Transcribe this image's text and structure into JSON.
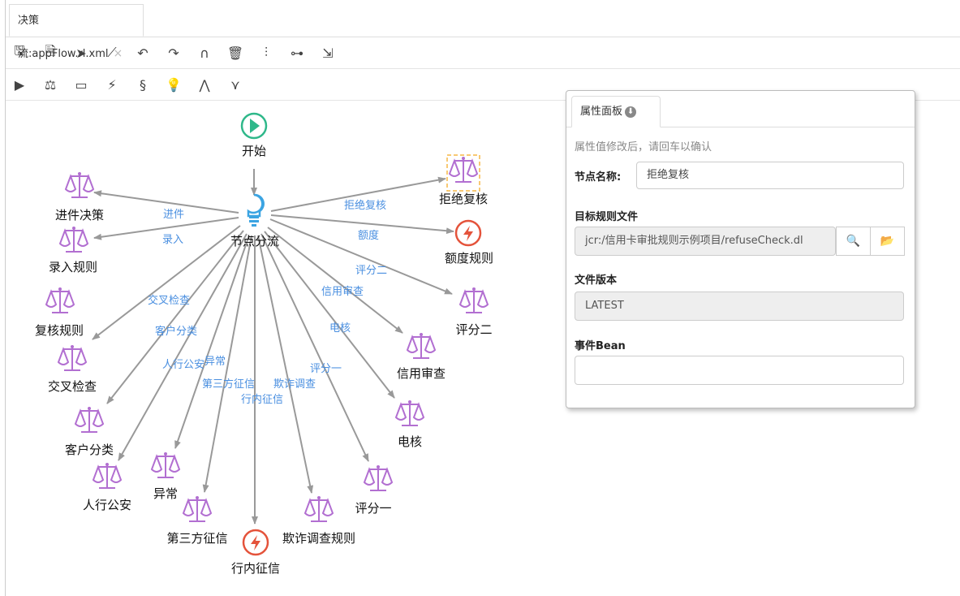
{
  "tab": {
    "title": "决策流:appFlow.rl.xml",
    "close": "×"
  },
  "toolbar1": [
    {
      "name": "save-icon",
      "glyph": "🖫"
    },
    {
      "name": "save-as-icon",
      "glyph": "🗎"
    },
    {
      "name": "pointer-icon",
      "glyph": "➤"
    },
    {
      "name": "connection-icon",
      "glyph": "⟋"
    },
    {
      "name": "undo-icon",
      "glyph": "↶"
    },
    {
      "name": "redo-icon",
      "glyph": "↷"
    },
    {
      "name": "magnet-icon",
      "glyph": "∩"
    },
    {
      "name": "delete-icon",
      "glyph": "🗑"
    },
    {
      "name": "align-vertical-icon",
      "glyph": "⫶"
    },
    {
      "name": "align-horizontal-icon",
      "glyph": "⊶"
    },
    {
      "name": "shrink-icon",
      "glyph": "⇲"
    }
  ],
  "toolbar2": [
    {
      "name": "start-node-icon",
      "glyph": "▶"
    },
    {
      "name": "rule-node-icon",
      "glyph": "⚖"
    },
    {
      "name": "package-node-icon",
      "glyph": "▭"
    },
    {
      "name": "action-node-icon",
      "glyph": "⚡"
    },
    {
      "name": "script-node-icon",
      "glyph": "§"
    },
    {
      "name": "decision-node-icon",
      "glyph": "💡"
    },
    {
      "name": "fork-node-icon",
      "glyph": "⋀"
    },
    {
      "name": "join-node-icon",
      "glyph": "⋎"
    }
  ],
  "flow": {
    "start": "开始",
    "split": "节点分流",
    "nodes": {
      "jinjian": "进件决策",
      "luru": "录入规则",
      "fuhe": "复核规则",
      "jiaocha": "交叉检查",
      "kehu": "客户分类",
      "renhang": "人行公安",
      "yichang": "异常",
      "disanfang": "第三方征信",
      "hangnei": "行内征信",
      "qizha": "欺诈调查规则",
      "pingfen1": "评分一",
      "dianhe": "电核",
      "xinyong": "信用审查",
      "pingfen2": "评分二",
      "edu": "额度规则",
      "jujue": "拒绝复核"
    },
    "edges": {
      "jinjian": "进件",
      "luru": "录入",
      "jiaocha": "交叉检查",
      "kehu": "客户分类",
      "renhang": "人行公安",
      "yichang": "异常",
      "disanfang": "第三方征信",
      "hangnei": "行内征信",
      "qizha": "欺诈调查",
      "pingfen1": "评分一",
      "dianhe": "电核",
      "xinyong": "信用审查",
      "pingfen2": "评分二",
      "edu": "额度",
      "jujue": "拒绝复核"
    }
  },
  "panel": {
    "tab": "属性面板",
    "hint": "属性值修改后，请回车以确认",
    "node_name_label": "节点名称:",
    "node_name_value": "拒绝复核",
    "target_file_label": "目标规则文件",
    "target_file_value": "jcr:/信用卡审批规则示例项目/refuseCheck.dl",
    "version_label": "文件版本",
    "version_value": "LATEST",
    "event_label": "事件Bean",
    "event_value": ""
  },
  "colors": {
    "rule": "#b26fd1",
    "start": "#2fb88a",
    "action": "#e4533b",
    "decision": "#3ba4e2",
    "edge": "#999999",
    "edge_label": "#4a8fe0",
    "selection": "#f5b746"
  }
}
